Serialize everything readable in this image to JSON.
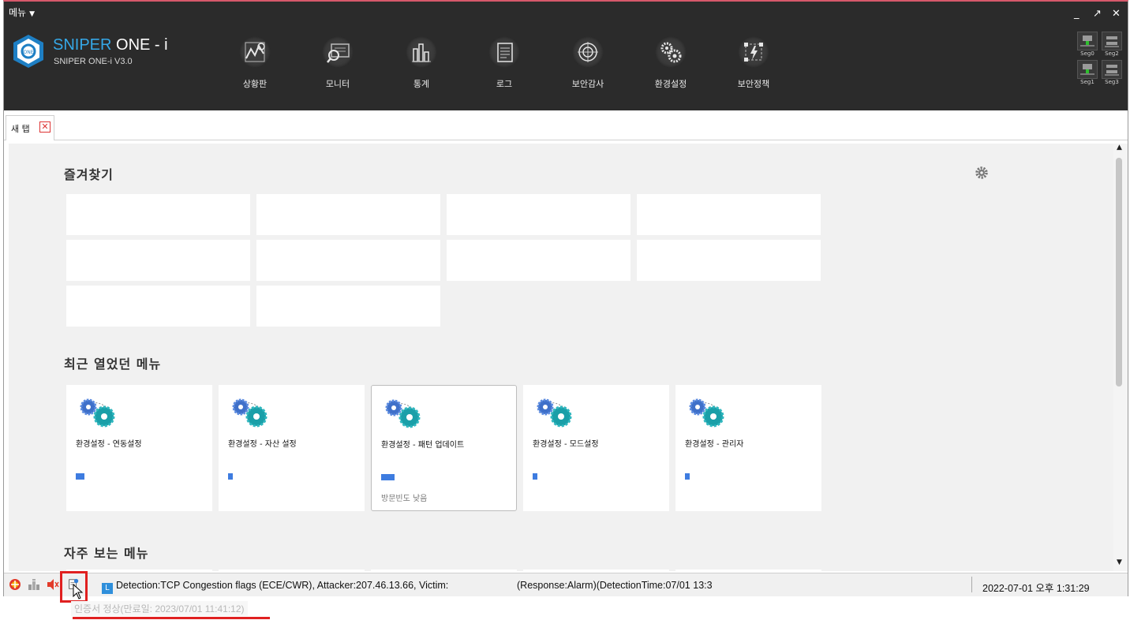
{
  "header": {
    "menu_label": "메뉴",
    "brand_prefix": "SNIPER",
    "brand_suffix": " ONE - i",
    "brand_sub": "SNIPER ONE-i V3.0",
    "logo_text": "ONE",
    "nav": [
      {
        "label": "상황판",
        "icon": "dashboard-icon"
      },
      {
        "label": "모니터",
        "icon": "monitor-icon"
      },
      {
        "label": "통계",
        "icon": "statistics-icon"
      },
      {
        "label": "로그",
        "icon": "log-icon"
      },
      {
        "label": "보안감사",
        "icon": "security-audit-icon"
      },
      {
        "label": "환경설정",
        "icon": "settings-gears-icon"
      },
      {
        "label": "보안정책",
        "icon": "security-policy-icon"
      }
    ],
    "window_controls": {
      "minimize": "_",
      "restore": "↗",
      "close": "✕"
    },
    "segments": [
      "Seg0",
      "Seg2",
      "Seg1",
      "Seg3"
    ]
  },
  "tab": {
    "label": "새 탭",
    "close": "✕"
  },
  "content": {
    "favorites_title": "즐겨찾기",
    "recent_title": "최근 열었던 메뉴",
    "frequent_title": "자주 보는 메뉴",
    "recent_cards": [
      {
        "name": "환경설정 - 연동설정",
        "usage": 0.06,
        "freq_label": ""
      },
      {
        "name": "환경설정 - 자산 설정",
        "usage": 0.03,
        "freq_label": ""
      },
      {
        "name": "환경설정 - 패턴 업데이트",
        "usage": 0.09,
        "freq_label": "방문빈도 낮음"
      },
      {
        "name": "환경설정 - 모드설정",
        "usage": 0.03,
        "freq_label": ""
      },
      {
        "name": "환경설정 - 관리자",
        "usage": 0.03,
        "freq_label": ""
      }
    ]
  },
  "statusbar": {
    "detection": "Detection:TCP Congestion flags (ECE/CWR), Attacker:207.46.13.66, Victim:",
    "detection_badge": "L",
    "response": "(Response:Alarm)(DetectionTime:07/01 13:3",
    "clock": "2022-07-01 오후 1:31:29",
    "tooltip": "인증서 정상(만료일: 2023/07/01 11:41:12)"
  },
  "colors": {
    "header_bg": "#2b2b2b",
    "accent": "#35a8e8",
    "bar": "#3e7ce0",
    "highlight": "#e02020"
  }
}
